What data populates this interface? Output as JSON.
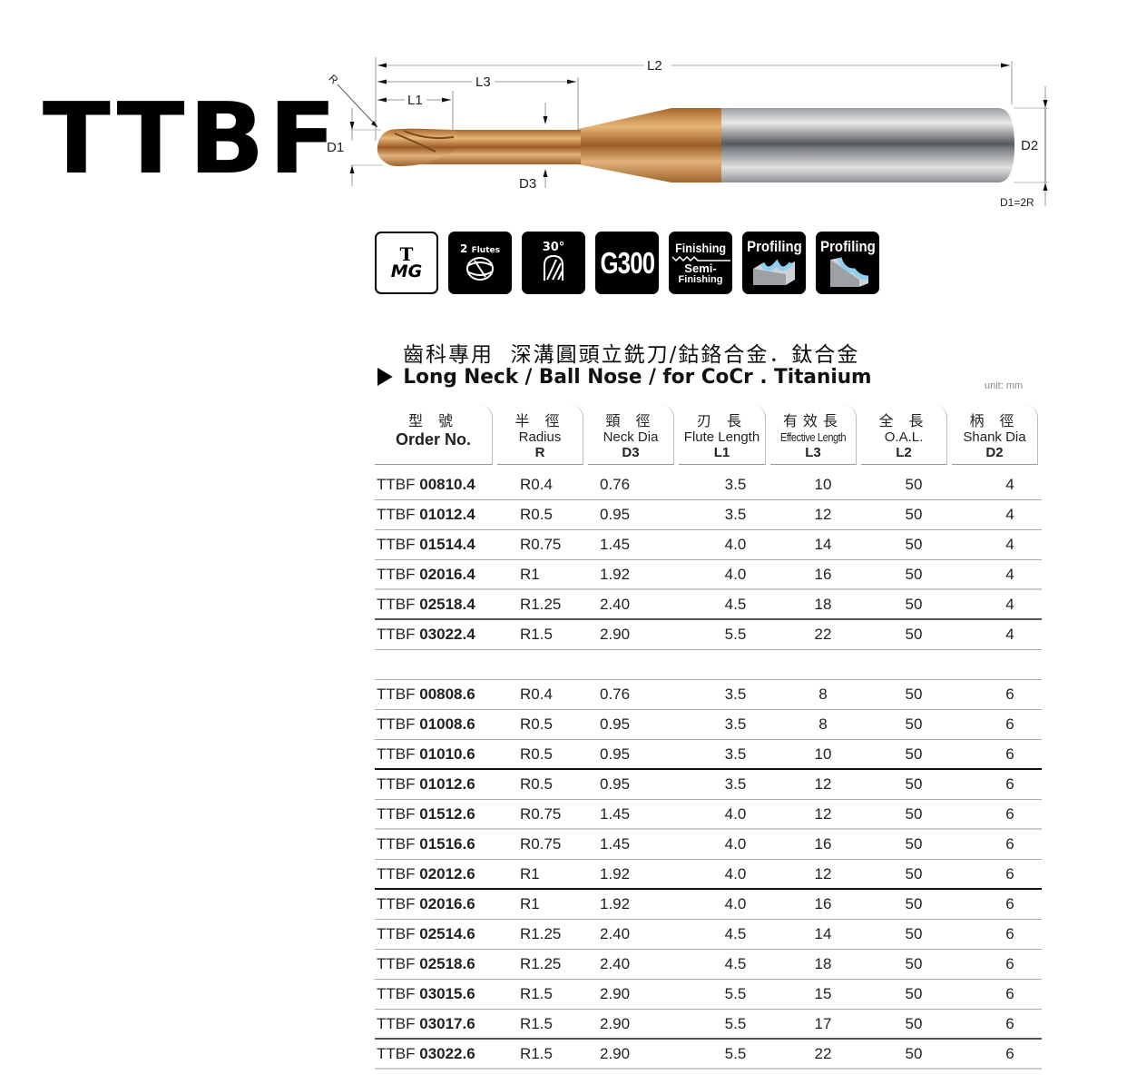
{
  "brand": {
    "code": "TTBF"
  },
  "diagram": {
    "labels": {
      "L2": "L2",
      "L3": "L3",
      "L1": "L1",
      "R": "R",
      "D1": "D1",
      "D2": "D2",
      "D3": "D3",
      "note": "D1=2R"
    },
    "colors": {
      "coating": "#c98f4e",
      "shank": "#b9bcbf"
    }
  },
  "icons": [
    {
      "name": "coating-tmg",
      "top": "T",
      "bottom": "MG"
    },
    {
      "name": "flutes",
      "count": "2",
      "label": "Flutes"
    },
    {
      "name": "helix-angle",
      "label": "30°"
    },
    {
      "name": "material-grade",
      "label": "G300"
    },
    {
      "name": "finishing",
      "top": "Finishing",
      "mid": "Semi-",
      "bottom": "Finishing"
    },
    {
      "name": "profiling-groove",
      "label": "Profiling"
    },
    {
      "name": "profiling-slope",
      "label": "Profiling"
    }
  ],
  "title": {
    "chinese": "齒科專用  深溝圓頭立銑刀/鈷鉻合金．鈦合金",
    "english": "Long Neck / Ball Nose / for CoCr . Titanium",
    "unit": "unit: mm"
  },
  "table": {
    "headers": [
      {
        "cn": "型 號",
        "en": "Order No.",
        "code": ""
      },
      {
        "cn": "半 徑",
        "en": "Radius",
        "code": "R"
      },
      {
        "cn": "頸 徑",
        "en": "Neck Dia",
        "code": "D3"
      },
      {
        "cn": "刃 長",
        "en": "Flute Length",
        "code": "L1"
      },
      {
        "cn": "有效長",
        "en": "Effective Length",
        "code": "L3"
      },
      {
        "cn": "全 長",
        "en": "O.A.L.",
        "code": "L2"
      },
      {
        "cn": "柄 徑",
        "en": "Shank Dia",
        "code": "D2"
      }
    ],
    "groups": [
      {
        "rows": [
          {
            "prefix": "TTBF",
            "code": "00810.4",
            "r": "R0.4",
            "d3": "0.76",
            "l1": "3.5",
            "l3": "10",
            "l2": "50",
            "d2": "4"
          },
          {
            "prefix": "TTBF",
            "code": "01012.4",
            "r": "R0.5",
            "d3": "0.95",
            "l1": "3.5",
            "l3": "12",
            "l2": "50",
            "d2": "4"
          },
          {
            "prefix": "TTBF",
            "code": "01514.4",
            "r": "R0.75",
            "d3": "1.45",
            "l1": "4.0",
            "l3": "14",
            "l2": "50",
            "d2": "4"
          },
          {
            "prefix": "TTBF",
            "code": "02016.4",
            "r": "R1",
            "d3": "1.92",
            "l1": "4.0",
            "l3": "16",
            "l2": "50",
            "d2": "4"
          },
          {
            "prefix": "TTBF",
            "code": "02518.4",
            "r": "R1.25",
            "d3": "2.40",
            "l1": "4.5",
            "l3": "18",
            "l2": "50",
            "d2": "4"
          },
          {
            "prefix": "TTBF",
            "code": "03022.4",
            "r": "R1.5",
            "d3": "2.90",
            "l1": "5.5",
            "l3": "22",
            "l2": "50",
            "d2": "4"
          }
        ]
      },
      {
        "rows": [
          {
            "prefix": "TTBF",
            "code": "00808.6",
            "r": "R0.4",
            "d3": "0.76",
            "l1": "3.5",
            "l3": "8",
            "l2": "50",
            "d2": "6"
          },
          {
            "prefix": "TTBF",
            "code": "01008.6",
            "r": "R0.5",
            "d3": "0.95",
            "l1": "3.5",
            "l3": "8",
            "l2": "50",
            "d2": "6"
          },
          {
            "prefix": "TTBF",
            "code": "01010.6",
            "r": "R0.5",
            "d3": "0.95",
            "l1": "3.5",
            "l3": "10",
            "l2": "50",
            "d2": "6"
          },
          {
            "prefix": "TTBF",
            "code": "01012.6",
            "r": "R0.5",
            "d3": "0.95",
            "l1": "3.5",
            "l3": "12",
            "l2": "50",
            "d2": "6"
          },
          {
            "prefix": "TTBF",
            "code": "01512.6",
            "r": "R0.75",
            "d3": "1.45",
            "l1": "4.0",
            "l3": "12",
            "l2": "50",
            "d2": "6"
          },
          {
            "prefix": "TTBF",
            "code": "01516.6",
            "r": "R0.75",
            "d3": "1.45",
            "l1": "4.0",
            "l3": "16",
            "l2": "50",
            "d2": "6"
          },
          {
            "prefix": "TTBF",
            "code": "02012.6",
            "r": "R1",
            "d3": "1.92",
            "l1": "4.0",
            "l3": "12",
            "l2": "50",
            "d2": "6"
          },
          {
            "prefix": "TTBF",
            "code": "02016.6",
            "r": "R1",
            "d3": "1.92",
            "l1": "4.0",
            "l3": "16",
            "l2": "50",
            "d2": "6"
          },
          {
            "prefix": "TTBF",
            "code": "02514.6",
            "r": "R1.25",
            "d3": "2.40",
            "l1": "4.5",
            "l3": "14",
            "l2": "50",
            "d2": "6"
          },
          {
            "prefix": "TTBF",
            "code": "02518.6",
            "r": "R1.25",
            "d3": "2.40",
            "l1": "4.5",
            "l3": "18",
            "l2": "50",
            "d2": "6"
          },
          {
            "prefix": "TTBF",
            "code": "03015.6",
            "r": "R1.5",
            "d3": "2.90",
            "l1": "5.5",
            "l3": "15",
            "l2": "50",
            "d2": "6"
          },
          {
            "prefix": "TTBF",
            "code": "03017.6",
            "r": "R1.5",
            "d3": "2.90",
            "l1": "5.5",
            "l3": "17",
            "l2": "50",
            "d2": "6"
          },
          {
            "prefix": "TTBF",
            "code": "03022.6",
            "r": "R1.5",
            "d3": "2.90",
            "l1": "5.5",
            "l3": "22",
            "l2": "50",
            "d2": "6"
          }
        ]
      }
    ]
  }
}
